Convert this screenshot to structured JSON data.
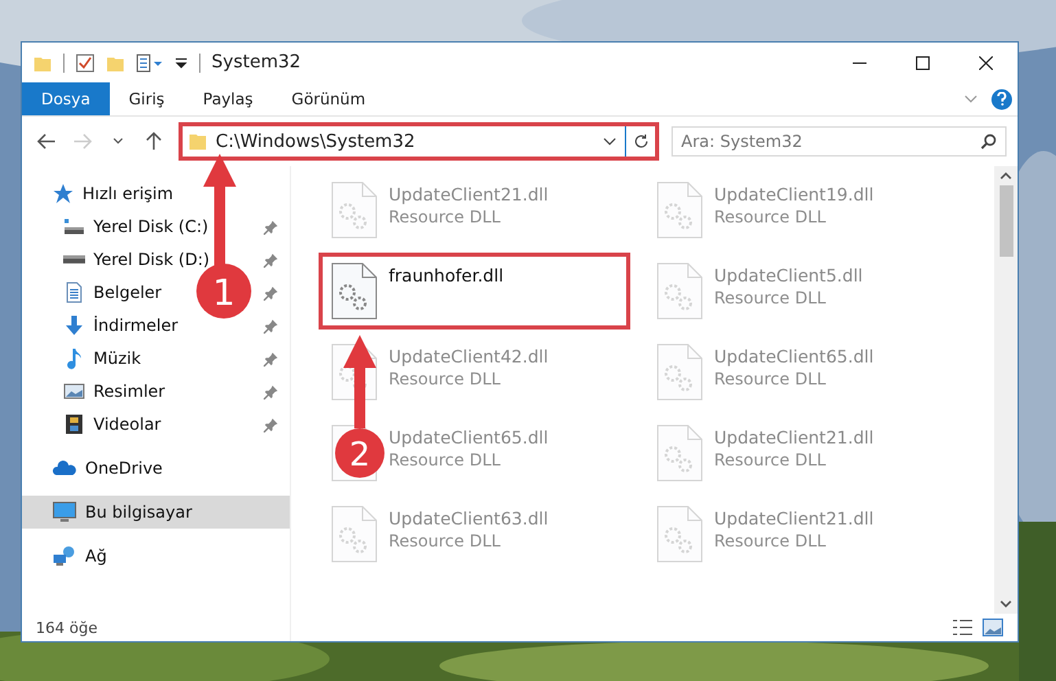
{
  "window": {
    "title": "System32"
  },
  "ribbon_tabs": [
    {
      "label": "Dosya",
      "kind": "file"
    },
    {
      "label": "Giriş",
      "kind": "tab"
    },
    {
      "label": "Paylaş",
      "kind": "tab"
    },
    {
      "label": "Görünüm",
      "kind": "tab"
    }
  ],
  "address": {
    "path": "C:\\Windows\\System32"
  },
  "search": {
    "placeholder": "Ara: System32"
  },
  "sidebar": {
    "items": [
      {
        "label": "Hızlı erişim",
        "selected": false,
        "children": [
          {
            "label": "Yerel Disk (C:)",
            "selected": false,
            "pinned": true
          },
          {
            "label": "Yerel Disk (D:)",
            "selected": false,
            "pinned": true
          },
          {
            "label": "Belgeler",
            "selected": false,
            "pinned": true
          },
          {
            "label": "İndirmeler",
            "selected": false,
            "pinned": true
          },
          {
            "label": "Müzik",
            "selected": false,
            "pinned": true
          },
          {
            "label": "Resimler",
            "selected": false,
            "pinned": true
          },
          {
            "label": "Videolar",
            "selected": false,
            "pinned": true
          }
        ]
      },
      {
        "label": "OneDrive",
        "selected": false
      },
      {
        "label": "Bu bilgisayar",
        "selected": true
      },
      {
        "label": "Ağ",
        "selected": false
      }
    ]
  },
  "files": [
    {
      "name": "UpdateClient21.dll",
      "type": "Resource DLL",
      "highlighted": false
    },
    {
      "name": "UpdateClient19.dll",
      "type": "Resource DLL",
      "highlighted": false
    },
    {
      "name": "fraunhofer.dll",
      "highlighted": true
    },
    {
      "name": "UpdateClient5.dll",
      "type": "Resource DLL",
      "highlighted": false
    },
    {
      "name": "UpdateClient42.dll",
      "type": "Resource DLL",
      "highlighted": false
    },
    {
      "name": "UpdateClient65.dll",
      "type": "Resource DLL",
      "highlighted": false
    },
    {
      "name": "UpdateClient65.dll",
      "type": "Resource DLL",
      "highlighted": false
    },
    {
      "name": "UpdateClient21.dll",
      "type": "Resource DLL",
      "highlighted": false
    },
    {
      "name": "UpdateClient63.dll",
      "type": "Resource DLL",
      "highlighted": false
    },
    {
      "name": "UpdateClient21.dll",
      "type": "Resource DLL",
      "highlighted": false
    }
  ],
  "status_bar": {
    "count": "164 öğe"
  },
  "annotations": [
    {
      "number": "1"
    },
    {
      "number": "2"
    }
  ]
}
